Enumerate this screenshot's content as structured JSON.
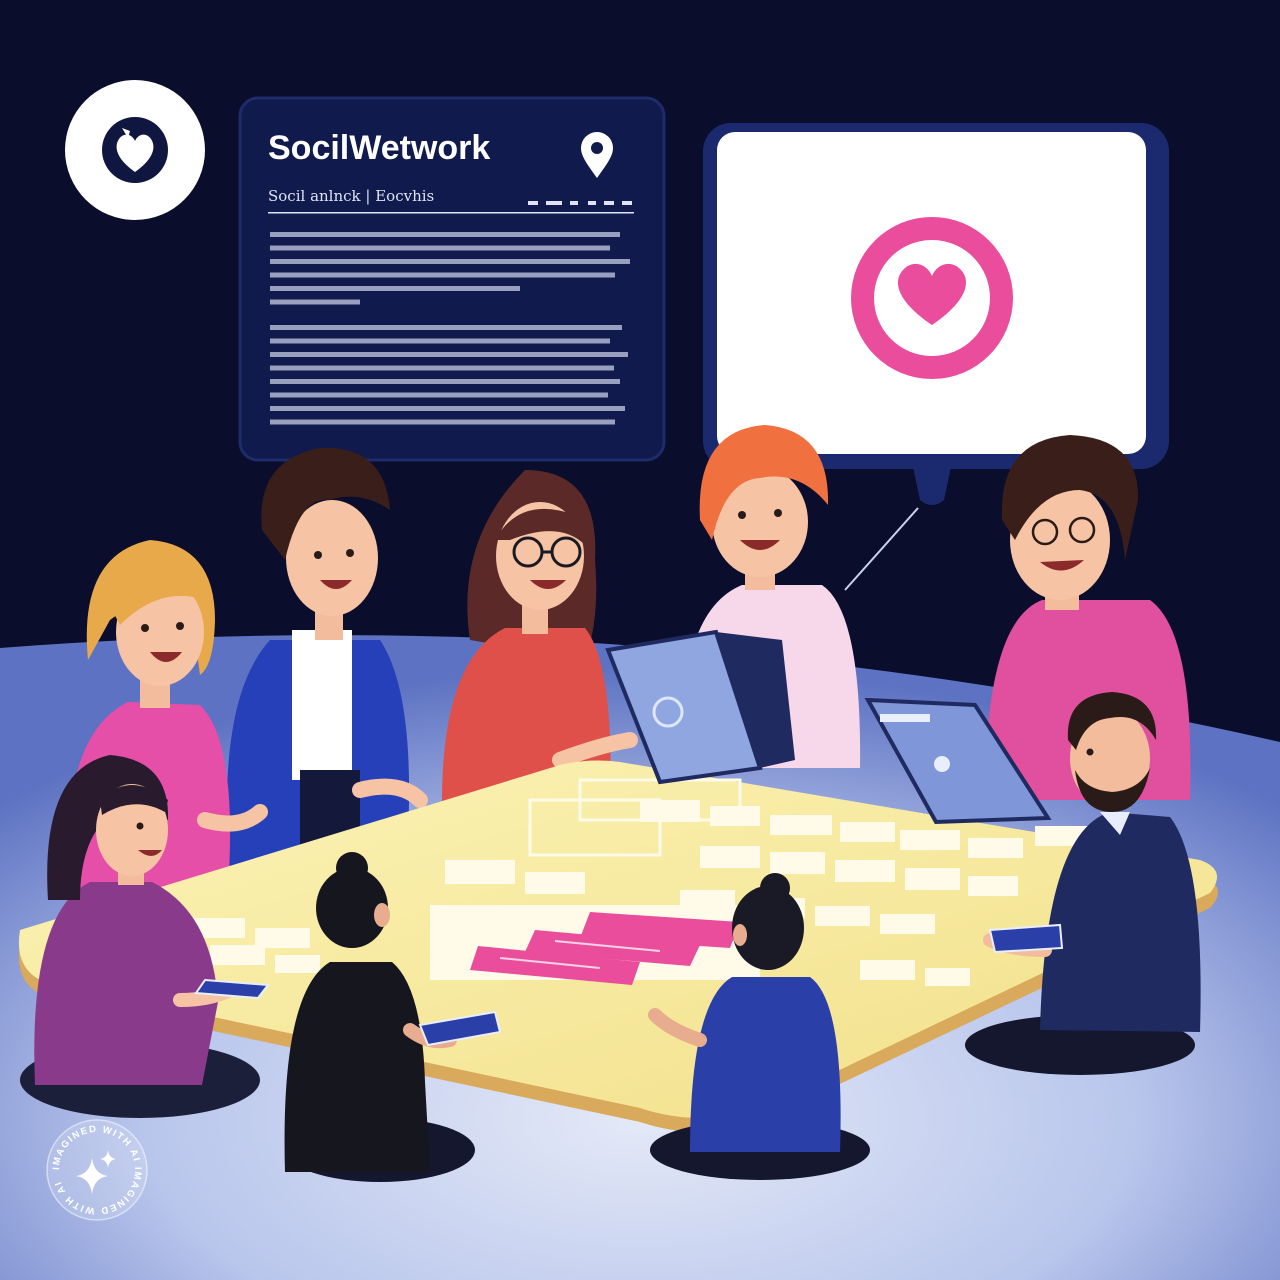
{
  "logo": {
    "icon": "globe-heart-icon"
  },
  "panel": {
    "title": "SocilWetwork",
    "subtitle": "Socil anlnck | Eocvhis",
    "icon": "location-pin-icon"
  },
  "bubble": {
    "icon": "heart-icon"
  },
  "watermark": {
    "text": "IMAGINED WITH AI  IMAGINED WITH AI"
  },
  "colors": {
    "background": "#0a0d2c",
    "panel": "#101a4c",
    "accent_pink": "#ea4d9c",
    "table": "#f6ec9e",
    "floor": "#c9d3ef"
  }
}
